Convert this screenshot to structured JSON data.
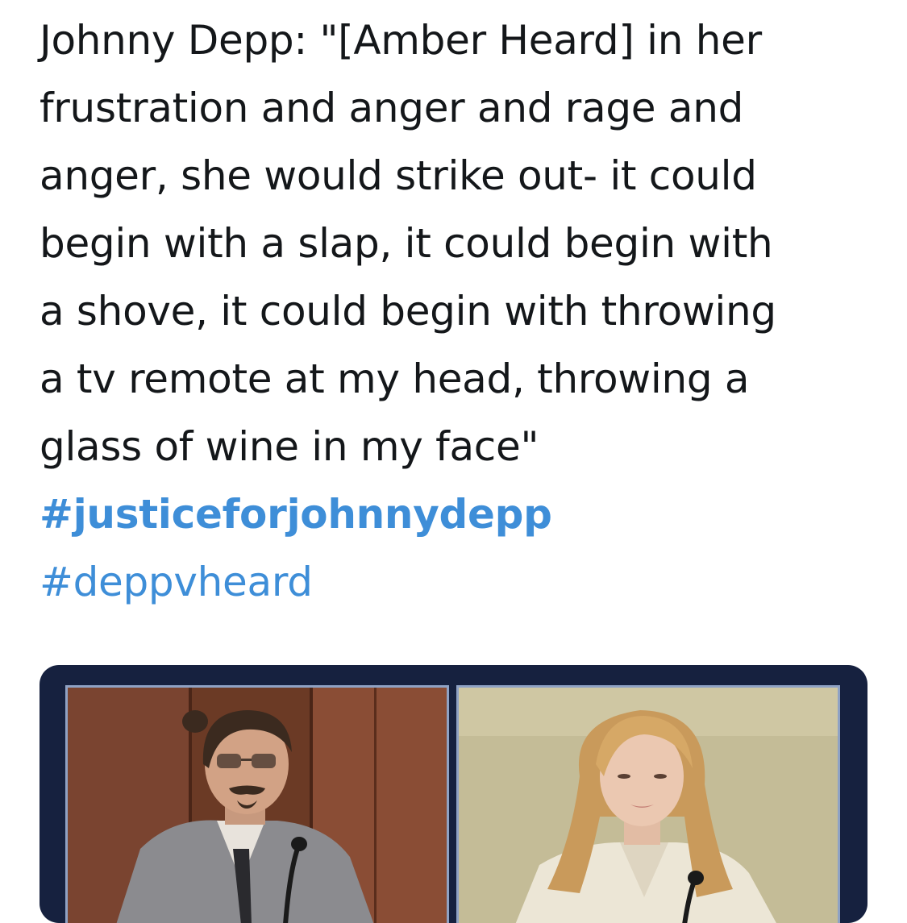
{
  "tweet": {
    "lines": [
      "Johnny Depp: \"[Amber Heard] in her",
      "frustration and anger and rage and",
      "anger, she would strike out- it could",
      "begin with a slap, it could begin with",
      "a shove, it could begin with throwing",
      "a tv remote at my head, throwing a",
      "glass of wine in my face\""
    ],
    "hashtags": [
      "#justiceforjohnnydepp",
      "#deppvheard"
    ]
  },
  "colors": {
    "text": "#14171a",
    "link": "#3e8ed8",
    "media_frame": "#16213f"
  },
  "media": {
    "panels": [
      {
        "subject": "man-in-gray-suit-at-witness-stand"
      },
      {
        "subject": "woman-with-blonde-hair-at-witness-stand"
      }
    ]
  }
}
